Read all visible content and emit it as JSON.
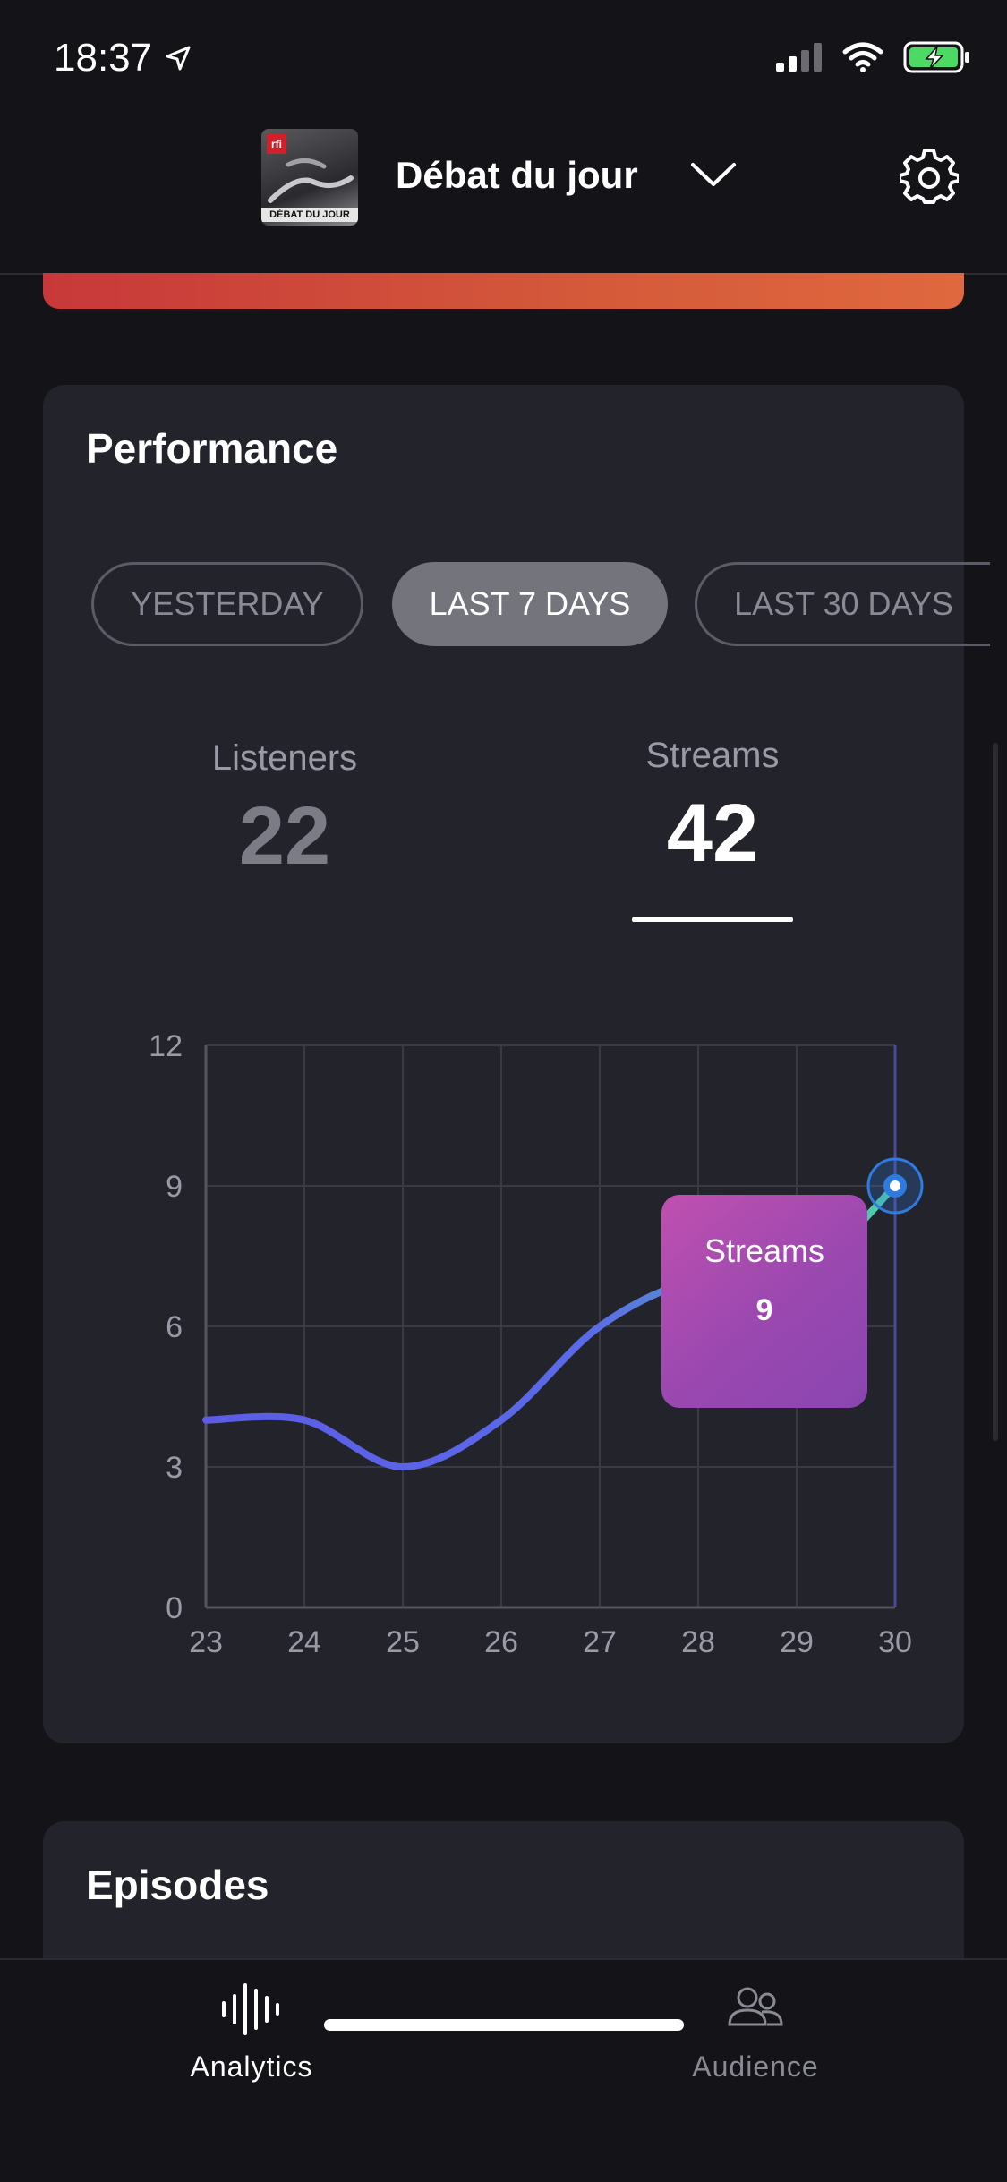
{
  "status": {
    "time": "18:37"
  },
  "header": {
    "podcast_title": "Débat du jour",
    "thumb_logo": "rfi",
    "thumb_caption": "DÉBAT DU JOUR"
  },
  "performance": {
    "title": "Performance",
    "filters": [
      "YESTERDAY",
      "LAST 7 DAYS",
      "LAST 30 DAYS"
    ],
    "selected_filter": "LAST 7 DAYS",
    "metrics": {
      "listeners_label": "Listeners",
      "listeners_value": "22",
      "streams_label": "Streams",
      "streams_value": "42"
    },
    "tooltip": {
      "label": "Streams",
      "value": "9"
    }
  },
  "chart_data": {
    "type": "line",
    "x": [
      23,
      24,
      25,
      26,
      27,
      28,
      29,
      30
    ],
    "values": [
      4,
      4,
      3,
      4,
      6,
      7,
      7,
      9
    ],
    "ylim": [
      0,
      12
    ],
    "yticks": [
      0,
      3,
      6,
      9,
      12
    ],
    "xticks": [
      "23",
      "24",
      "25",
      "26",
      "27",
      "28",
      "29",
      "30"
    ],
    "grid": true,
    "highlight_x": 30,
    "colors": {
      "line_start": "#5c5ce6",
      "line_end": "#4fd1a8",
      "grid": "#3a3a44",
      "point": "#2f7be0"
    }
  },
  "episodes": {
    "title": "Episodes"
  },
  "tabbar": {
    "analytics_label": "Analytics",
    "audience_label": "Audience"
  }
}
